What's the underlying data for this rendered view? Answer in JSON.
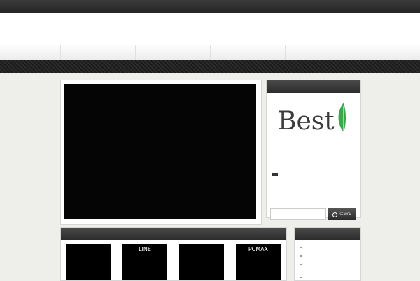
{
  "topbar": {
    "text": ""
  },
  "header": {
    "site_title": ""
  },
  "nav": {
    "items": [
      {
        "label": ""
      },
      {
        "label": ""
      },
      {
        "label": ""
      },
      {
        "label": ""
      }
    ]
  },
  "slider": {
    "lines": [
      "",
      "",
      "",
      "",
      ""
    ],
    "caption": "",
    "thumbs": [
      {
        "label": ""
      },
      {
        "label": ""
      },
      {
        "label": ""
      },
      {
        "label": ""
      },
      {
        "label": ""
      },
      {
        "label": ""
      }
    ]
  },
  "sidebar_feature": {
    "heading": "",
    "logo_text": "Best",
    "post_title": "",
    "excerpt": "",
    "more_label": ""
  },
  "search": {
    "value": "",
    "button_label": "SEARCH"
  },
  "new_posts": {
    "heading": "",
    "cards": [
      {
        "lines": [
          "",
          "",
          "",
          ""
        ]
      },
      {
        "lines": [
          "LINE",
          "",
          "",
          ""
        ]
      },
      {
        "lines": [
          "",
          "",
          "",
          ""
        ]
      },
      {
        "lines": [
          "PCMAX",
          "",
          "",
          ""
        ]
      }
    ]
  },
  "categories": {
    "heading": "",
    "items": [
      {
        "label": ""
      },
      {
        "label": ""
      },
      {
        "label": ""
      },
      {
        "label": ""
      }
    ]
  },
  "colors": {
    "link": "#2a6bb8",
    "logo_leaf": "#3aa84a",
    "logo_text": "#3a3a3a"
  }
}
